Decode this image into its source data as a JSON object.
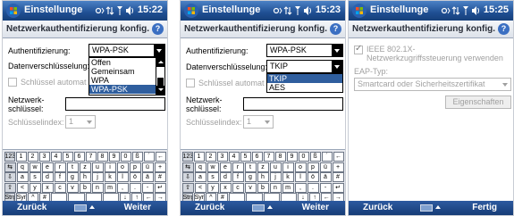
{
  "screens": [
    {
      "title": "Einstellunge",
      "time": "15:22",
      "subtitle": "Netzwerkauthentifizierung konfig.",
      "auth_label": "Authentifizierung:",
      "auth_value": "WPA-PSK",
      "auth_options": [
        "Offen",
        "Gemeinsam",
        "WPA",
        "WPA-PSK"
      ],
      "auth_selected_index": 3,
      "enc_label": "Datenverschlüsselung:",
      "key_auto_label": "Schlüssel automatisch bereitstellen",
      "net_key_label": "Netzwerk-\nschlüssel:",
      "key_index_label": "Schlüsselindex:",
      "key_index_value": "1",
      "softkey_left": "Zurück",
      "softkey_right": "Weiter"
    },
    {
      "title": "Einstellunge",
      "time": "15:23",
      "subtitle": "Netzwerkauthentifizierung konfig.",
      "auth_label": "Authentifizierung:",
      "auth_value": "WPA-PSK",
      "enc_label": "Datenverschlüsselung:",
      "enc_value": "TKIP",
      "enc_options": [
        "TKIP",
        "AES"
      ],
      "enc_selected_index": 0,
      "key_auto_label": "Schlüssel automatisch bereitstellen",
      "net_key_label": "Netzwerk-\nschlüssel:",
      "key_index_label": "Schlüsselindex:",
      "key_index_value": "1",
      "softkey_left": "Zurück",
      "softkey_right": "Weiter"
    },
    {
      "title": "Einstellunge",
      "time": "15:25",
      "subtitle": "Netzwerkauthentifizierung konfig.",
      "ieee_label": "IEEE 802.1X-Netzwerkzugriffssteuerung verwenden",
      "ieee_checked": true,
      "eap_label": "EAP-Typ:",
      "eap_value": "Smartcard oder Sicherheitszertifikat",
      "properties_button": "Eigenschaften",
      "softkey_left": "Zurück",
      "softkey_right": "Fertig"
    }
  ],
  "keyboard": {
    "row1": [
      "123",
      "1",
      "2",
      "3",
      "4",
      "5",
      "6",
      "7",
      "8",
      "9",
      "0",
      "ß",
      "´",
      "←"
    ],
    "row2": [
      "⇆",
      "q",
      "w",
      "e",
      "r",
      "t",
      "z",
      "u",
      "i",
      "o",
      "p",
      "ü",
      "+"
    ],
    "row3": [
      "⇩",
      "a",
      "s",
      "d",
      "f",
      "g",
      "h",
      "j",
      "k",
      "l",
      "ö",
      "ä",
      "#"
    ],
    "row4": [
      "⇧",
      "<",
      "y",
      "x",
      "c",
      "v",
      "b",
      "n",
      "m",
      ",",
      ".",
      "-",
      "↵"
    ],
    "row5": [
      "Strg",
      "Sym",
      "^",
      "#",
      "",
      "",
      "",
      "",
      "↓",
      "↑",
      "←",
      "→"
    ]
  },
  "colors": {
    "titlebar": "#1f4f93",
    "selection": "#2f5e9e",
    "softbar": "#163c76"
  }
}
